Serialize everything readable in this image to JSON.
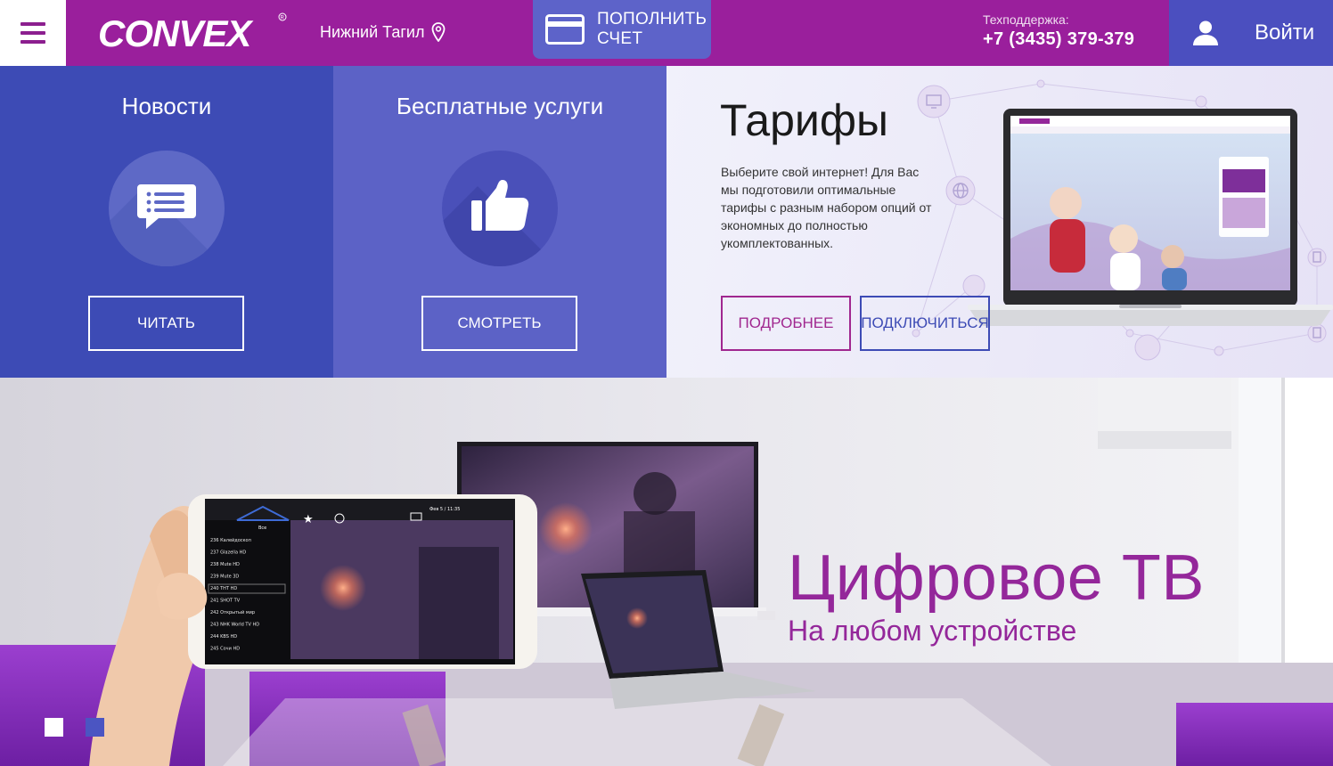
{
  "header": {
    "logo_text": "CONVEX",
    "city": "Нижний Тагил",
    "topup_label_1": "ПОПОЛНИТЬ",
    "topup_label_2": "СЧЕТ",
    "support_label": "Техподдержка:",
    "support_phone": "+7 (3435) 379-379",
    "login_label": "Войти"
  },
  "news": {
    "title": "Новости",
    "button": "ЧИТАТЬ"
  },
  "free": {
    "title": "Бесплатные услуги",
    "button": "СМОТРЕТЬ"
  },
  "tariffs": {
    "title": "Тарифы",
    "description": "Выберите свой интернет! Для Вас мы подготовили оптимальные тарифы с разным набором опций от экономных до полностью укомплектованных.",
    "more_button": "ПОДРОБНЕЕ",
    "connect_button": "ПОДКЛЮЧИТЬСЯ"
  },
  "hero": {
    "title": "Цифровое ТВ",
    "subtitle": "На любом устройстве",
    "phone_channels": [
      "236 Калейдоскоп",
      "237 Glazella HD",
      "238 Mute HD",
      "239 Mute 3D",
      "240 ТНТ HD",
      "241 SHOT TV",
      "242 Открытый мир",
      "243 NHK World TV HD",
      "244 KBS HD",
      "245 Сочи HD"
    ],
    "phone_tab": "Все",
    "phone_time": "Фев 5 / 11:35"
  },
  "colors": {
    "brand_purple": "#9a1f9c",
    "accent_blue": "#3d4bb5",
    "accent_violet": "#5c62c6"
  }
}
